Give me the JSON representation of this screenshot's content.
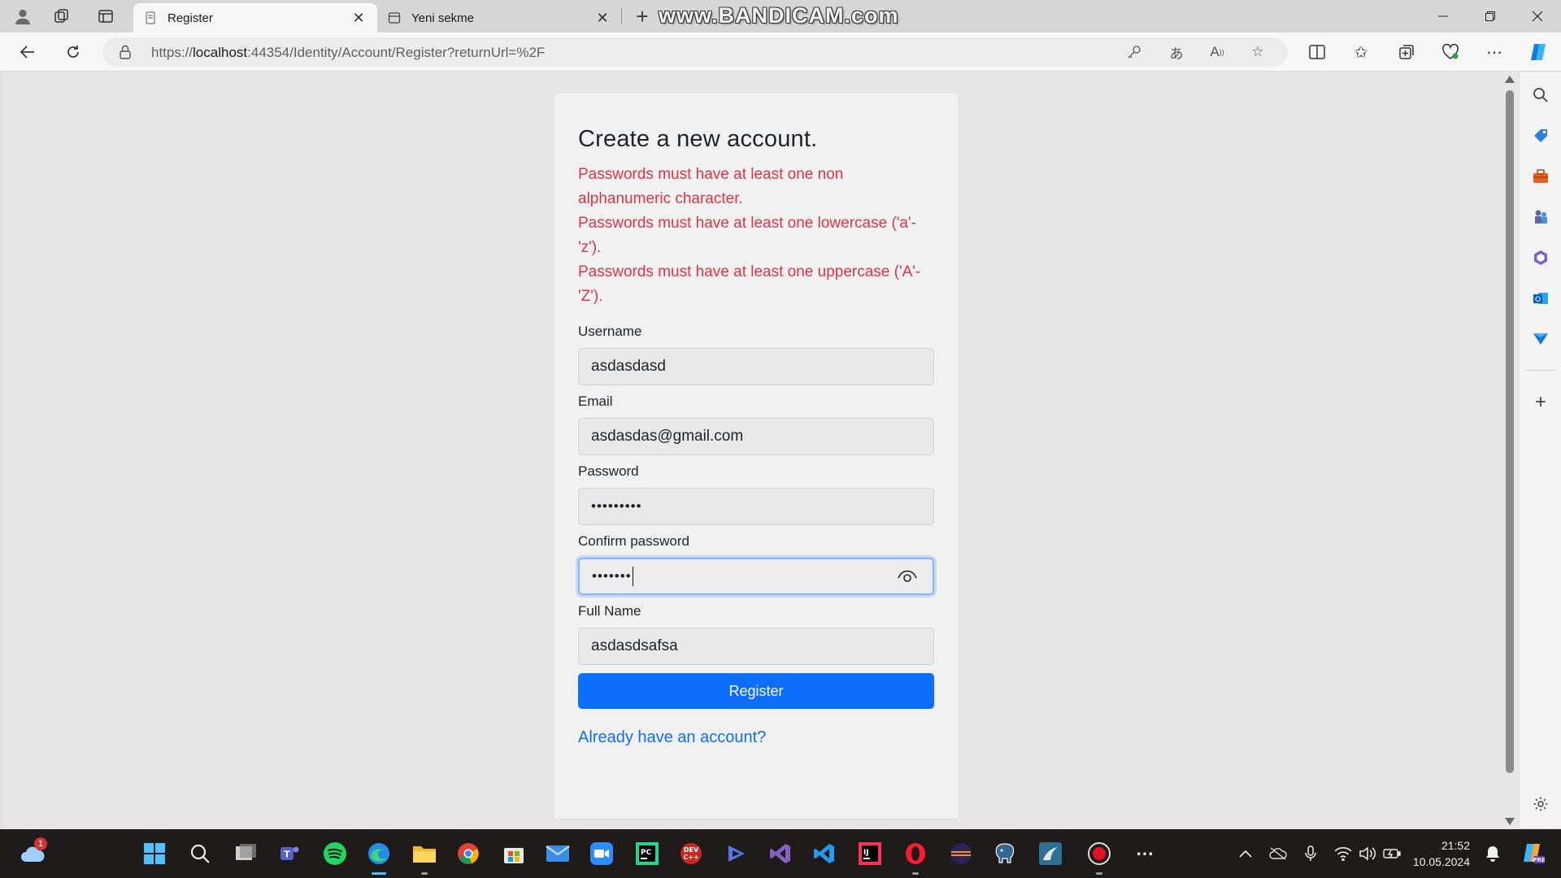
{
  "browser": {
    "tabs": [
      {
        "title": "Register",
        "active": true
      },
      {
        "title": "Yeni sekme",
        "active": false
      }
    ],
    "watermark": "www.BANDICAM.com",
    "url": {
      "scheme": "https://",
      "host": "localhost",
      "rest": ":44354/Identity/Account/Register?returnUrl=%2F"
    }
  },
  "page": {
    "title": "Create a new account.",
    "errors": [
      "Passwords must have at least one non alphanumeric character.",
      "Passwords must have at least one lowercase ('a'-'z').",
      "Passwords must have at least one uppercase ('A'-'Z')."
    ],
    "fields": {
      "username": {
        "label": "Username",
        "value": "asdasdasd"
      },
      "email": {
        "label": "Email",
        "value": "asdasdas@gmail.com"
      },
      "password": {
        "label": "Password",
        "value": "•••••••••"
      },
      "confirm_password": {
        "label": "Confirm password",
        "value": "•••••••"
      },
      "full_name": {
        "label": "Full Name",
        "value": "asdasdsafsa"
      }
    },
    "register_label": "Register",
    "login_link": "Already have an account?"
  },
  "taskbar": {
    "notification_count": "1",
    "time": "21:52",
    "date": "10.05.2024",
    "apps": [
      "start",
      "search",
      "task-view",
      "teams",
      "spotify",
      "edge",
      "file-explorer",
      "chrome",
      "store",
      "mail",
      "zoom",
      "pycharm",
      "devcpp",
      "bandicut",
      "visual-studio",
      "vscode",
      "intellij",
      "opera",
      "eclipse",
      "postgresql",
      "mysql-workbench",
      "bandicam"
    ]
  },
  "colors": {
    "accent": "#0d6efd",
    "error": "#dc3545",
    "focus_ring": "#86b7fe"
  }
}
